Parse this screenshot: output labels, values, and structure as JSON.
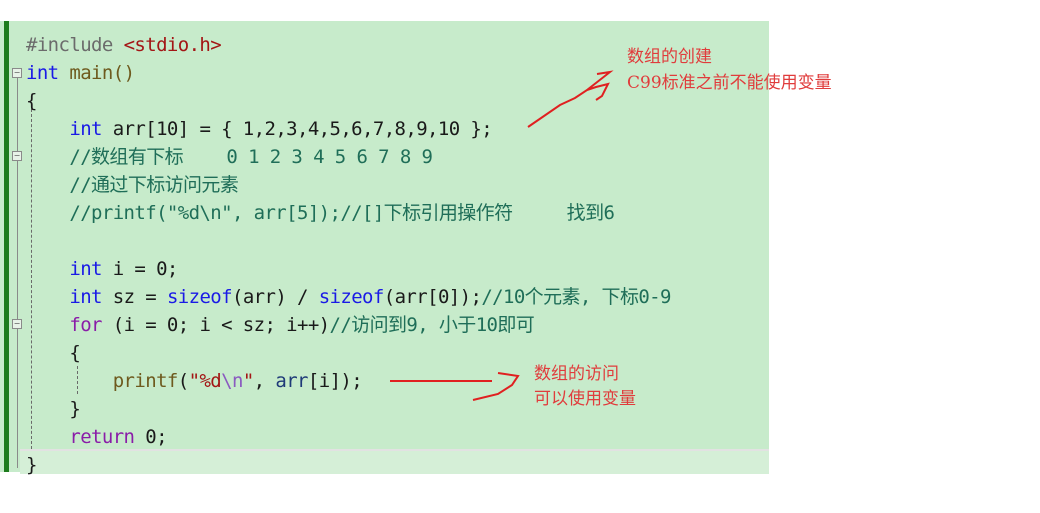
{
  "editor": {
    "lines": [
      {
        "parts": [
          {
            "t": "#include ",
            "c": "pp"
          },
          {
            "t": "<stdio.h>",
            "c": "inc"
          }
        ]
      },
      {
        "parts": [
          {
            "t": "int",
            "c": "kw"
          },
          {
            "t": " main()",
            "c": "fn"
          }
        ]
      },
      {
        "parts": [
          {
            "t": "{",
            "c": ""
          }
        ]
      },
      {
        "parts": [
          {
            "t": "    ",
            "c": ""
          },
          {
            "t": "int",
            "c": "kw"
          },
          {
            "t": " arr[10] = { 1,2,3,4,5,6,7,8,9,10 };",
            "c": ""
          }
        ]
      },
      {
        "parts": [
          {
            "t": "    //数组有下标    0 1 2 3 4 5 6 7 8 9",
            "c": "cm"
          }
        ]
      },
      {
        "parts": [
          {
            "t": "    //通过下标访问元素",
            "c": "cm"
          }
        ]
      },
      {
        "parts": [
          {
            "t": "    //printf(\"%d\\n\", arr[5]);//[]下标引用操作符     找到6",
            "c": "cm"
          }
        ]
      },
      {
        "parts": [
          {
            "t": "",
            "c": ""
          }
        ]
      },
      {
        "parts": [
          {
            "t": "    ",
            "c": ""
          },
          {
            "t": "int",
            "c": "kw"
          },
          {
            "t": " i = 0;",
            "c": ""
          }
        ]
      },
      {
        "parts": [
          {
            "t": "    ",
            "c": ""
          },
          {
            "t": "int",
            "c": "kw"
          },
          {
            "t": " sz = ",
            "c": ""
          },
          {
            "t": "sizeof",
            "c": "kw"
          },
          {
            "t": "(arr) / ",
            "c": ""
          },
          {
            "t": "sizeof",
            "c": "kw"
          },
          {
            "t": "(arr[0]);",
            "c": ""
          },
          {
            "t": "//10个元素, 下标0-9",
            "c": "cm"
          }
        ]
      },
      {
        "parts": [
          {
            "t": "    ",
            "c": ""
          },
          {
            "t": "for",
            "c": "ctrl"
          },
          {
            "t": " (i = 0; i < sz; i++)",
            "c": ""
          },
          {
            "t": "//访问到9, 小于10即可",
            "c": "cm"
          }
        ]
      },
      {
        "parts": [
          {
            "t": "    {",
            "c": ""
          }
        ]
      },
      {
        "parts": [
          {
            "t": "        ",
            "c": ""
          },
          {
            "t": "printf",
            "c": "fn"
          },
          {
            "t": "(",
            "c": ""
          },
          {
            "t": "\"%d",
            "c": "str"
          },
          {
            "t": "\\n",
            "c": "esc"
          },
          {
            "t": "\"",
            "c": "str"
          },
          {
            "t": ", ",
            "c": ""
          },
          {
            "t": "arr",
            "c": "var"
          },
          {
            "t": "[i]);",
            "c": ""
          }
        ]
      },
      {
        "parts": [
          {
            "t": "    }",
            "c": ""
          }
        ]
      },
      {
        "parts": [
          {
            "t": "    ",
            "c": ""
          },
          {
            "t": "return",
            "c": "ctrl"
          },
          {
            "t": " 0;",
            "c": ""
          }
        ]
      },
      {
        "parts": [
          {
            "t": "}",
            "c": ""
          }
        ]
      }
    ],
    "fold_markers": [
      "⊟",
      "⊟",
      "⊟"
    ]
  },
  "annotations": {
    "creation_title": "数组的创建",
    "creation_note": "C99标准之前不能使用变量",
    "access_title": "数组的访问",
    "access_note": "可以使用变量"
  },
  "colors": {
    "background": "#c7ebcb",
    "annotation": "#e03c3c"
  }
}
